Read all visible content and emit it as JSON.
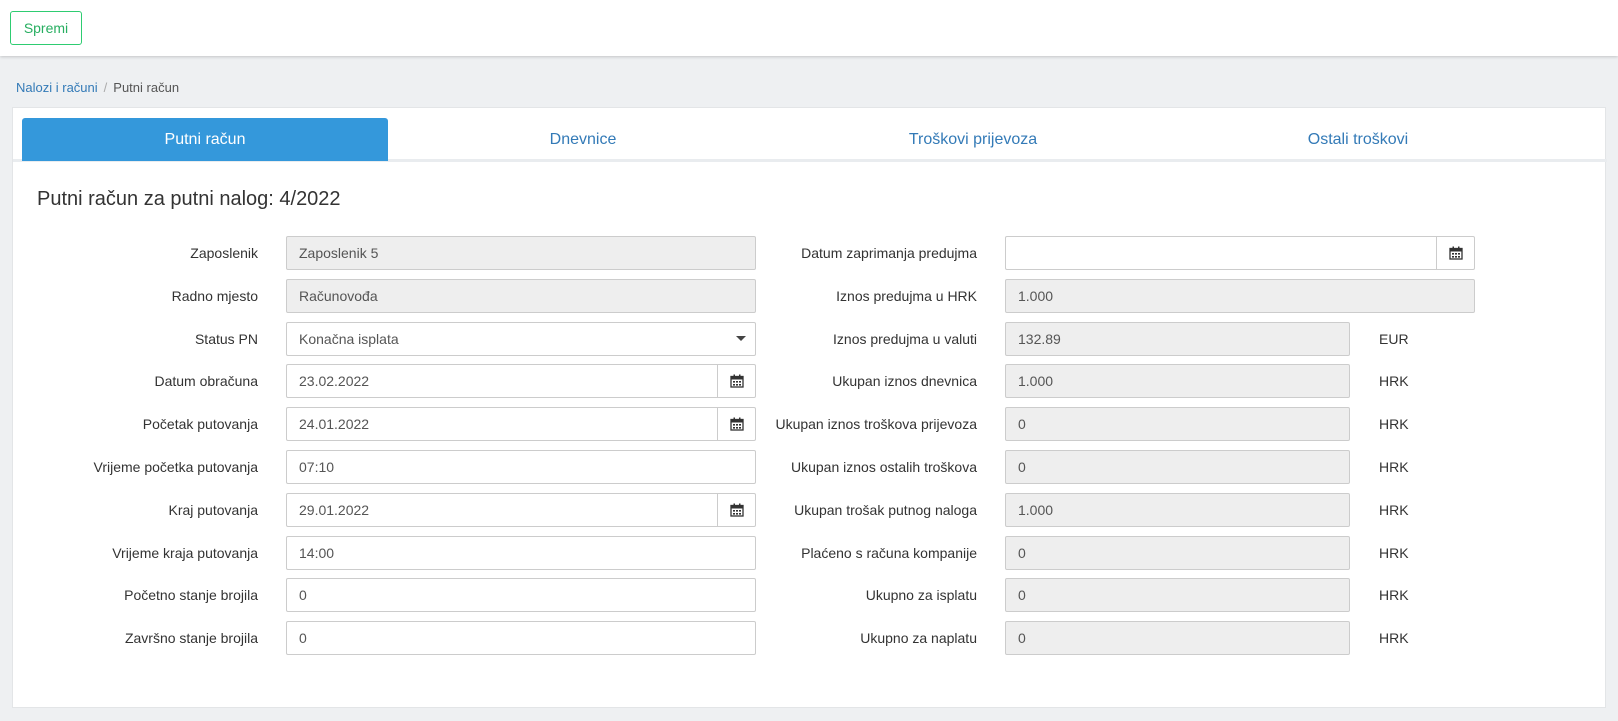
{
  "toolbar": {
    "save_label": "Spremi"
  },
  "breadcrumb": {
    "parent": "Nalozi i računi",
    "current": "Putni račun"
  },
  "tabs": [
    {
      "label": "Putni račun",
      "active": true
    },
    {
      "label": "Dnevnice",
      "active": false
    },
    {
      "label": "Troškovi prijevoza",
      "active": false
    },
    {
      "label": "Ostali troškovi",
      "active": false
    }
  ],
  "form": {
    "title": "Putni račun za putni nalog: 4/2022",
    "left": [
      {
        "label": "Zaposlenik",
        "value": "Zaposlenik 5",
        "type": "readonly"
      },
      {
        "label": "Radno mjesto",
        "value": "Računovođa",
        "type": "readonly"
      },
      {
        "label": "Status PN",
        "value": "Konačna isplata",
        "type": "select"
      },
      {
        "label": "Datum obračuna",
        "value": "23.02.2022",
        "type": "date"
      },
      {
        "label": "Početak putovanja",
        "value": "24.01.2022",
        "type": "date"
      },
      {
        "label": "Vrijeme početka putovanja",
        "value": "07:10",
        "type": "text"
      },
      {
        "label": "Kraj putovanja",
        "value": "29.01.2022",
        "type": "date"
      },
      {
        "label": "Vrijeme kraja putovanja",
        "value": "14:00",
        "type": "text"
      },
      {
        "label": "Početno stanje brojila",
        "value": "0",
        "type": "text"
      },
      {
        "label": "Završno stanje brojila",
        "value": "0",
        "type": "text"
      }
    ],
    "right": [
      {
        "label": "Datum zaprimanja predujma",
        "value": "",
        "type": "date",
        "unit": ""
      },
      {
        "label": "Iznos predujma u HRK",
        "value": "1.000",
        "type": "readonly-wide",
        "unit": ""
      },
      {
        "label": "Iznos predujma u valuti",
        "value": "132.89",
        "type": "readonly",
        "unit": "EUR"
      },
      {
        "label": "Ukupan iznos dnevnica",
        "value": "1.000",
        "type": "readonly",
        "unit": "HRK"
      },
      {
        "label": "Ukupan iznos troškova prijevoza",
        "value": "0",
        "type": "readonly",
        "unit": "HRK"
      },
      {
        "label": "Ukupan iznos ostalih troškova",
        "value": "0",
        "type": "readonly",
        "unit": "HRK"
      },
      {
        "label": "Ukupan trošak putnog naloga",
        "value": "1.000",
        "type": "readonly",
        "unit": "HRK"
      },
      {
        "label": "Plaćeno s računa kompanije",
        "value": "0",
        "type": "readonly",
        "unit": "HRK"
      },
      {
        "label": "Ukupno za isplatu",
        "value": "0",
        "type": "readonly",
        "unit": "HRK"
      },
      {
        "label": "Ukupno za naplatu",
        "value": "0",
        "type": "readonly",
        "unit": "HRK"
      }
    ]
  },
  "icons": {
    "calendar": "calendar-icon",
    "dropdown": "chevron-down-icon"
  },
  "colors": {
    "accent": "#3498db",
    "save": "#2ecc71",
    "link": "#337ab7",
    "readonly_bg": "#eeeeee"
  }
}
